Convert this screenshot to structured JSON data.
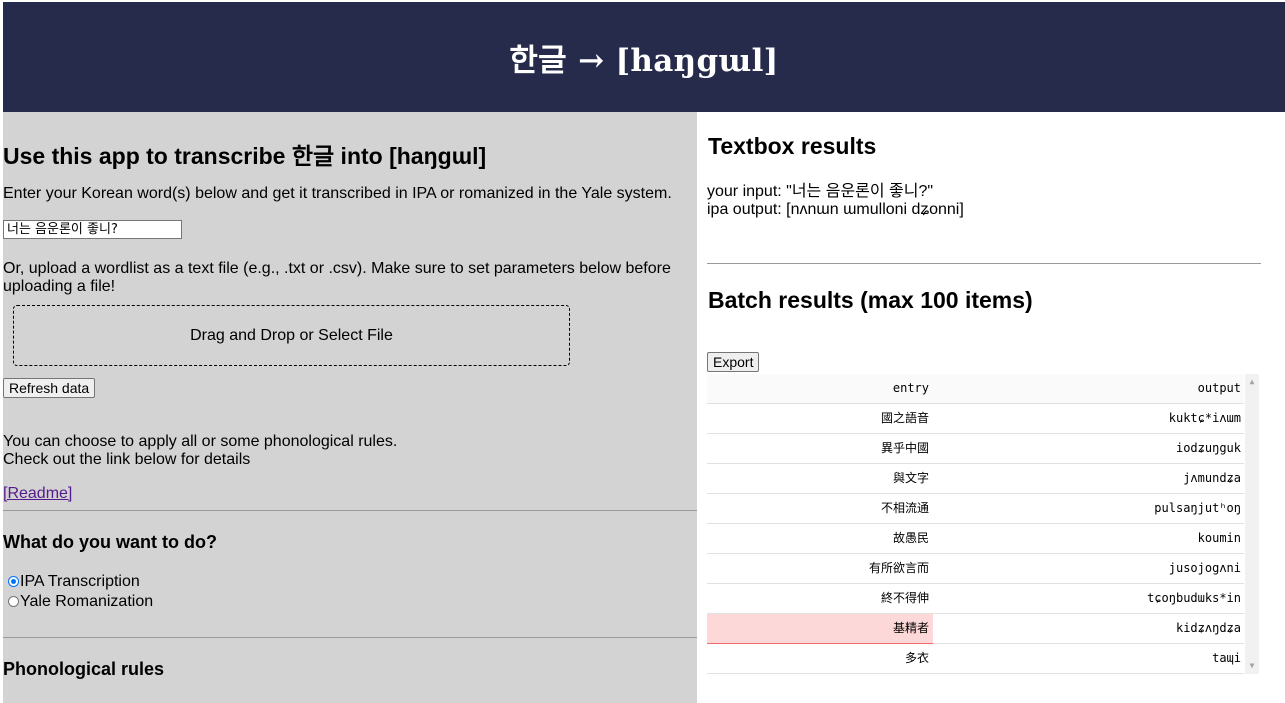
{
  "header": {
    "title": "한글 → [haŋgɯl]"
  },
  "left": {
    "heading": "Use this app to transcribe 한글 into [haŋgɯl]",
    "intro": "Enter your Korean word(s) below and get it transcribed in IPA or romanized in the Yale system.",
    "input_value": "너는 음운론이 좋니?",
    "upload_text": "Or, upload a wordlist as a text file (e.g., .txt or .csv). Make sure to set parameters below before uploading a file!",
    "upload_line1": "Or, upload a wordlist as a text file (e.g., .txt or .csv). Make sure to set parameters below before",
    "upload_line2": "uploading a file!",
    "dropzone_label": "Drag and Drop or Select File",
    "refresh_label": "Refresh data",
    "rules_line1": "You can choose to apply all or some phonological rules.",
    "rules_line2": "Check out the link below for details",
    "readme_link": "[Readme]",
    "mode_heading": "What do you want to do?",
    "options": [
      {
        "label": "IPA Transcription",
        "selected": true
      },
      {
        "label": "Yale Romanization",
        "selected": false
      }
    ],
    "phon_heading": "Phonological rules"
  },
  "right": {
    "textbox_heading": "Textbox results",
    "your_input": "your input: \"너는 음운론이 좋니?\"",
    "ipa_output": "ipa output: [nʌnɯn ɯmulloni dʑonni]",
    "batch_heading": "Batch results (max 100 items)",
    "export_label": "Export",
    "table": {
      "columns": [
        "entry",
        "output"
      ],
      "rows": [
        {
          "entry": "國之語音",
          "output": "kuktɕ*iʌɯm",
          "highlight": false
        },
        {
          "entry": "異乎中國",
          "output": "iodʑuŋguk",
          "highlight": false
        },
        {
          "entry": "與文字",
          "output": "jʌmundʑa",
          "highlight": false
        },
        {
          "entry": "不相流通",
          "output": "pulsaŋjutʰoŋ",
          "highlight": false
        },
        {
          "entry": "故愚民",
          "output": "koumin",
          "highlight": false
        },
        {
          "entry": "有所欲言而",
          "output": "jusojogʌni",
          "highlight": false
        },
        {
          "entry": "終不得伸",
          "output": "tɕoŋbudɯks*in",
          "highlight": false
        },
        {
          "entry": "基精者",
          "output": "kidʑʌŋdʑa",
          "highlight": true
        },
        {
          "entry": "多衣",
          "output": "taɰi",
          "highlight": false
        }
      ]
    }
  },
  "colors": {
    "header_bg": "#262b4b",
    "left_bg": "#d3d3d3",
    "highlight": "#fdd8d8",
    "radio_accent": "#0075ff",
    "link": "#551a8b"
  }
}
